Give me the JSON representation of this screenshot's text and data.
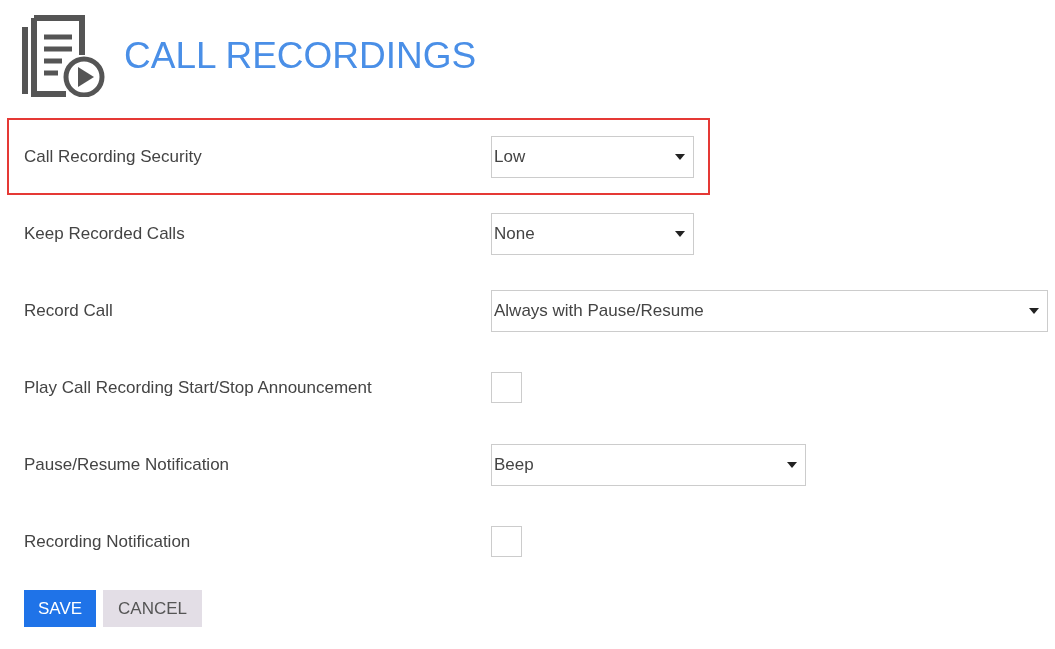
{
  "title": "CALL RECORDINGS",
  "settings": [
    {
      "kind": "select",
      "label": "Call Recording Security",
      "value": "Low",
      "highlighted": true
    },
    {
      "kind": "select",
      "label": "Keep Recorded Calls",
      "value": "None",
      "highlighted": false
    },
    {
      "kind": "select",
      "label": "Record Call",
      "value": "Always with Pause/Resume",
      "highlighted": false
    },
    {
      "kind": "checkbox",
      "label": "Play Call Recording Start/Stop Announcement",
      "checked": false,
      "highlighted": false
    },
    {
      "kind": "select",
      "label": "Pause/Resume Notification",
      "value": "Beep",
      "highlighted": false
    },
    {
      "kind": "checkbox",
      "label": "Recording Notification",
      "checked": false,
      "highlighted": false
    }
  ],
  "buttons": [
    {
      "kind": "primary",
      "label": "SAVE"
    },
    {
      "kind": "secondary",
      "label": "CANCEL"
    }
  ]
}
